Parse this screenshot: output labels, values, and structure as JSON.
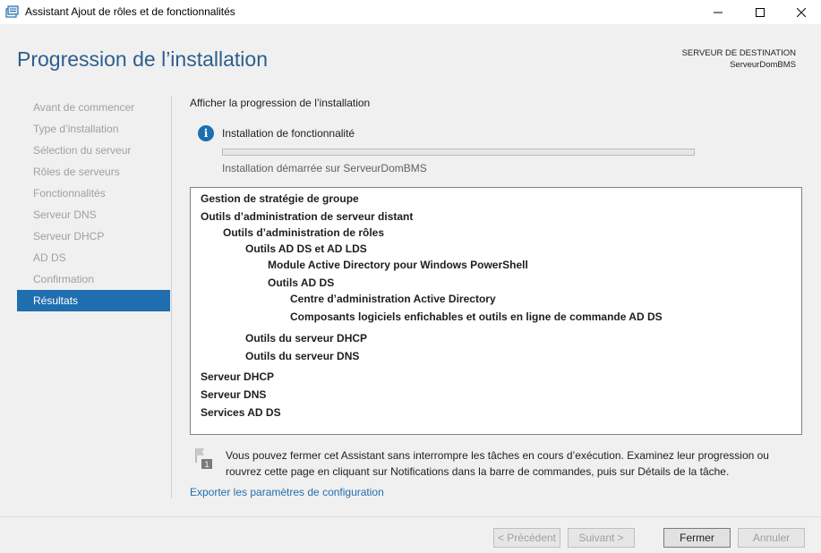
{
  "window": {
    "title": "Assistant Ajout de rôles et de fonctionnalités"
  },
  "header": {
    "title": "Progression de l’installation",
    "destination_label": "SERVEUR DE DESTINATION",
    "destination_server": "ServeurDomBMS"
  },
  "nav": {
    "items": [
      {
        "label": "Avant de commencer",
        "active": false
      },
      {
        "label": "Type d’installation",
        "active": false
      },
      {
        "label": "Sélection du serveur",
        "active": false
      },
      {
        "label": "Rôles de serveurs",
        "active": false
      },
      {
        "label": "Fonctionnalités",
        "active": false
      },
      {
        "label": "Serveur DNS",
        "active": false
      },
      {
        "label": "Serveur DHCP",
        "active": false
      },
      {
        "label": "AD DS",
        "active": false
      },
      {
        "label": "Confirmation",
        "active": false
      },
      {
        "label": "Résultats",
        "active": true
      }
    ]
  },
  "content": {
    "section_label": "Afficher la progression de l’installation",
    "status_title": "Installation de fonctionnalité",
    "progress_fraction": 0,
    "progress_text": "Installation démarrée sur ServeurDomBMS",
    "results": [
      {
        "text": "Gestion de stratégie de groupe",
        "level": 0
      },
      {
        "text": "Outils d’administration de serveur distant",
        "level": 0
      },
      {
        "text": "Outils d’administration de rôles",
        "level": 1
      },
      {
        "text": "Outils AD DS et AD LDS",
        "level": 2
      },
      {
        "text": "Module Active Directory pour Windows PowerShell",
        "level": 3
      },
      {
        "text": "Outils AD DS",
        "level": 3
      },
      {
        "text": "Centre d’administration Active Directory",
        "level": 4
      },
      {
        "text": "Composants logiciels enfichables et outils en ligne de commande AD DS",
        "level": 4
      },
      {
        "text": "Outils du serveur DHCP",
        "level": 2
      },
      {
        "text": "Outils du serveur DNS",
        "level": 2
      },
      {
        "text": "Serveur DHCP",
        "level": 0
      },
      {
        "text": "Serveur DNS",
        "level": 0
      },
      {
        "text": "Services AD DS",
        "level": 0
      }
    ],
    "notice_text": "Vous pouvez fermer cet Assistant sans interrompre les tâches en cours d’exécution. Examinez leur progression ou rouvrez cette page en cliquant sur Notifications dans la barre de commandes, puis sur Détails de la tâche.",
    "notice_badge": "1",
    "export_link": "Exporter les paramètres de configuration"
  },
  "footer": {
    "previous": "< Précédent",
    "next": "Suivant >",
    "close": "Fermer",
    "cancel": "Annuler"
  },
  "colors": {
    "title_blue": "#2d5e8e",
    "accent_blue": "#1f6fb0",
    "nav_disabled": "#a0a0a0"
  }
}
